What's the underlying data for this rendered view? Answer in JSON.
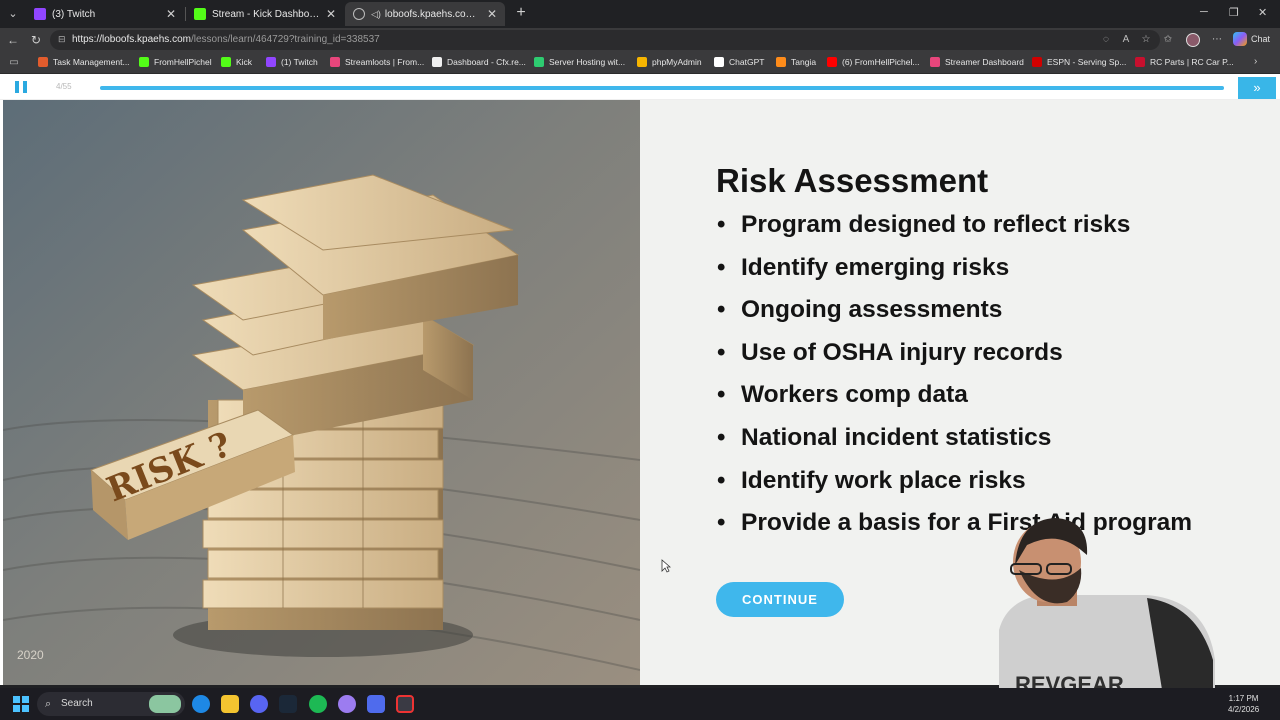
{
  "browser": {
    "tabs": [
      {
        "title": "(3) Twitch",
        "color": "#9146ff",
        "active": false
      },
      {
        "title": "Stream - Kick Dashboard",
        "color": "#53fc18",
        "active": false
      },
      {
        "title": "loboofs.kpaehs.com/lessons/l...",
        "color": "#9aa0a6",
        "active": true
      }
    ],
    "url_host": "https://loboofs.kpaehs.com",
    "url_path": "/lessons/learn/464729?training_id=338537",
    "profile_label": "Chat"
  },
  "bookmarks": [
    {
      "label": "Task Management...",
      "color": "#e25c2d"
    },
    {
      "label": "FromHellPichel",
      "color": "#53fc18"
    },
    {
      "label": "Kick",
      "color": "#53fc18"
    },
    {
      "label": "(1) Twitch",
      "color": "#9146ff"
    },
    {
      "label": "Streamloots | From...",
      "color": "#e8467c"
    },
    {
      "label": "Dashboard - Cfx.re...",
      "color": "#f0f0f0"
    },
    {
      "label": "Server Hosting wit...",
      "color": "#2ecc71"
    },
    {
      "label": "phpMyAdmin",
      "color": "#f7b500"
    },
    {
      "label": "ChatGPT",
      "color": "#ffffff"
    },
    {
      "label": "Tangia",
      "color": "#ff8c1a"
    },
    {
      "label": "(6) FromHellPichel...",
      "color": "#ff0000"
    },
    {
      "label": "Streamer Dashboard",
      "color": "#e8467c"
    },
    {
      "label": "ESPN - Serving Sp...",
      "color": "#d00000"
    },
    {
      "label": "RC Parts | RC Car P...",
      "color": "#c8102e"
    }
  ],
  "player": {
    "counter": "4/55",
    "progress": 1.0,
    "accent": "#3fb7ec"
  },
  "slide": {
    "title": "Risk Assessment",
    "bullets": [
      "Program designed to reflect risks",
      "Identify emerging risks",
      "Ongoing assessments",
      "Use of OSHA injury records",
      "Workers comp data",
      "National incident statistics",
      "Identify work place risks",
      "Provide a basis for a First Aid program"
    ],
    "continue_label": "CONTINUE"
  },
  "photo": {
    "block_text": "RISK ?",
    "watermark": "2020"
  },
  "webcam": {
    "shirt_text": "REVGEAR"
  },
  "taskbar": {
    "search_label": "Search",
    "time": "1:17 PM",
    "date": "4/2/2026"
  }
}
